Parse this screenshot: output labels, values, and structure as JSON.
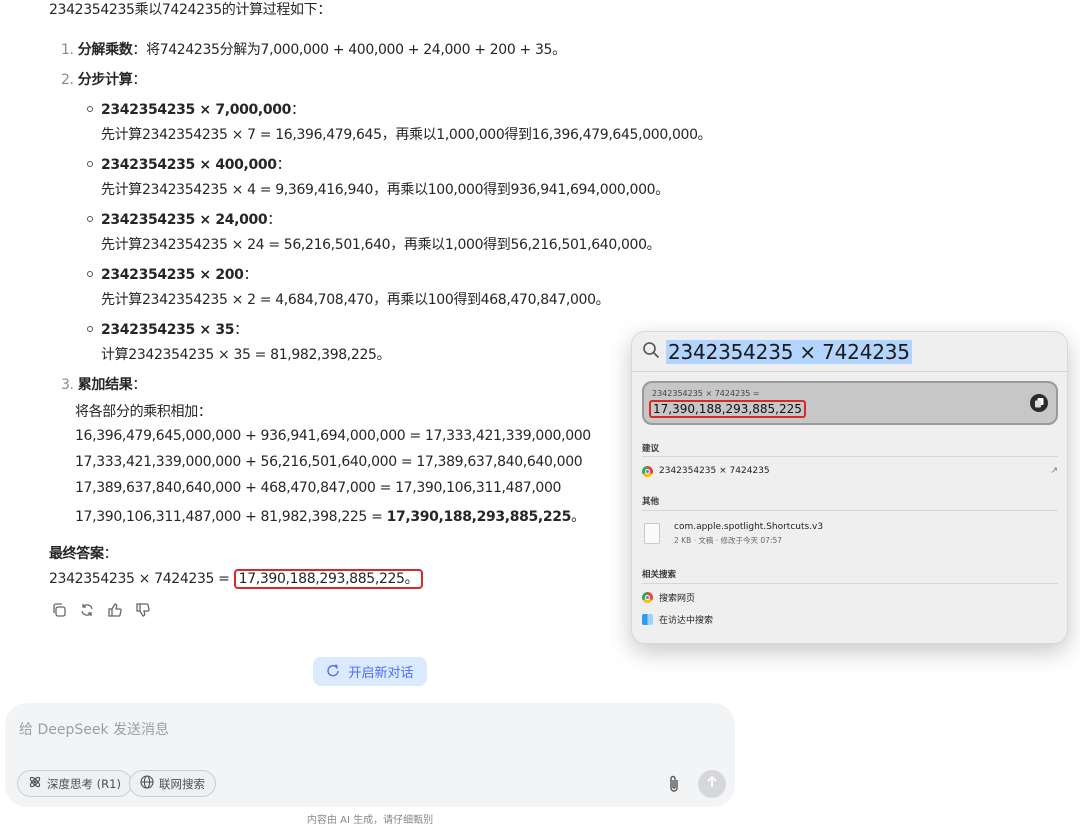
{
  "chat": {
    "intro": "2342354235乘以7424235的计算过程如下：",
    "step1": {
      "num": "1.",
      "title": "分解乘数",
      "text": "：将7424235分解为7,000,000 + 400,000 + 24,000 + 200 + 35。"
    },
    "step2": {
      "num": "2.",
      "title": "分步计算",
      "colon": "："
    },
    "sub": [
      {
        "title": "2342354235 × 7,000,000",
        "colon": "：",
        "detail": "先计算2342354235 × 7 = 16,396,479,645，再乘以1,000,000得到16,396,479,645,000,000。"
      },
      {
        "title": "2342354235 × 400,000",
        "colon": "：",
        "detail": "先计算2342354235 × 4 = 9,369,416,940，再乘以100,000得到936,941,694,000,000。"
      },
      {
        "title": "2342354235 × 24,000",
        "colon": "：",
        "detail": "先计算2342354235 × 24 = 56,216,501,640，再乘以1,000得到56,216,501,640,000。"
      },
      {
        "title": "2342354235 × 200",
        "colon": "：",
        "detail": "先计算2342354235 × 2 = 4,684,708,470，再乘以100得到468,470,847,000。"
      },
      {
        "title": "2342354235 × 35",
        "colon": "：",
        "detail": "计算2342354235 × 35 = 81,982,398,225。"
      }
    ],
    "step3": {
      "num": "3.",
      "title": "累加结果",
      "colon": "：",
      "lead": "将各部分的乘积相加："
    },
    "sums": [
      "16,396,479,645,000,000 + 936,941,694,000,000 = 17,333,421,339,000,000",
      "17,333,421,339,000,000 + 56,216,501,640,000 = 17,389,637,840,640,000",
      "17,389,637,840,640,000 + 468,470,847,000 = 17,390,106,311,487,000"
    ],
    "sum_last_prefix": "17,390,106,311,487,000 + 81,982,398,225 = ",
    "sum_last_bold": "17,390,188,293,885,225",
    "sum_last_suffix": "。",
    "final_title": "最终答案",
    "final_colon": "：",
    "final_prefix": "2342354235 × 7424235 = ",
    "final_value": "17,390,188,293,885,225。"
  },
  "actions": {
    "icons": [
      "copy-icon",
      "regenerate-icon",
      "thumbs-up-icon",
      "thumbs-down-icon"
    ]
  },
  "new_chat_label": "开启新对话",
  "composer": {
    "placeholder": "给 DeepSeek 发送消息",
    "deep_think_label": "深度思考 (R1)",
    "web_search_label": "联网搜索"
  },
  "disclaimer": "内容由 AI 生成，请仔细甄别",
  "spotlight": {
    "query": "2342354235 × 7424235",
    "calc_expr": "2342354235 × 7424235  =",
    "calc_result": "17,390,188,293,885,225",
    "section_suggest": "建议",
    "suggest_item": "2342354235 × 7424235",
    "section_other": "其他",
    "file_name": "com.apple.spotlight.Shortcuts.v3",
    "file_meta": "2 KB · 文稿 · 修改于今天 07:57",
    "section_related": "相关搜索",
    "related": [
      "搜索网页",
      "在访达中搜索"
    ]
  },
  "colors": {
    "accent": "#4d6bfe",
    "highlight_box": "#d62a2a",
    "selection": "#b3d4fc"
  }
}
